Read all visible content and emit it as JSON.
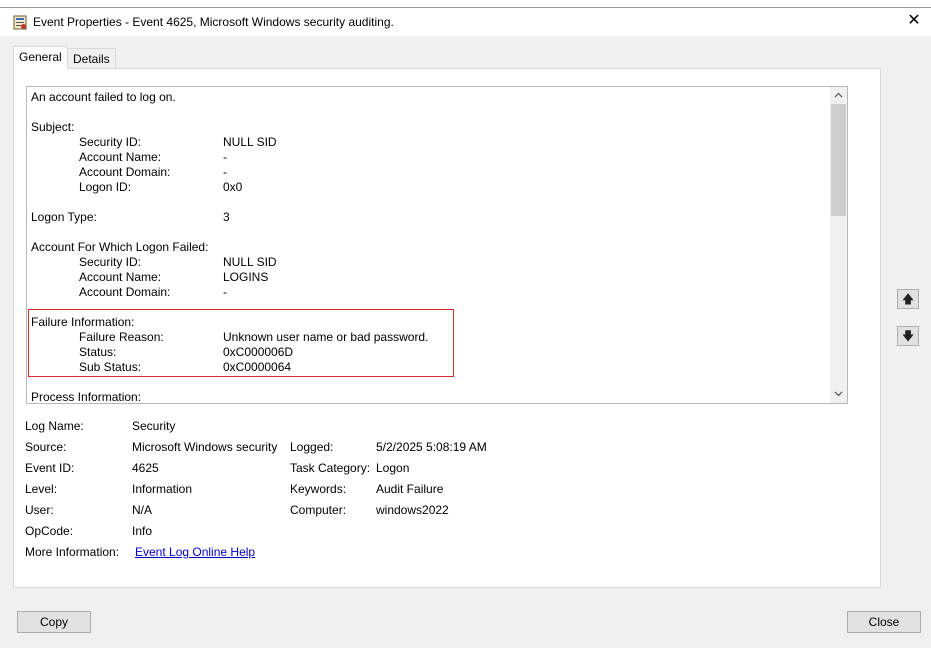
{
  "window": {
    "title": "Event Properties - Event 4625, Microsoft Windows security auditing.",
    "close_glyph": "✕"
  },
  "tabs": [
    {
      "label": "General",
      "active": true
    },
    {
      "label": "Details",
      "active": false
    }
  ],
  "description": {
    "lines": {
      "summary": "An account failed to log on.",
      "subject_header": "Subject:",
      "subj_sid_label": "Security ID:",
      "subj_sid_value": "NULL SID",
      "subj_name_label": "Account Name:",
      "subj_name_value": "-",
      "subj_domain_label": "Account Domain:",
      "subj_domain_value": "-",
      "subj_logonid_label": "Logon ID:",
      "subj_logonid_value": "0x0",
      "logon_type_label": "Logon Type:",
      "logon_type_value": "3",
      "failed_header": "Account For Which Logon Failed:",
      "fail_sid_label": "Security ID:",
      "fail_sid_value": "NULL SID",
      "fail_name_label": "Account Name:",
      "fail_name_value": "LOGINS",
      "fail_domain_label": "Account Domain:",
      "fail_domain_value": "-",
      "failure_header": "Failure Information:",
      "reason_label": "Failure Reason:",
      "reason_value": "Unknown user name or bad password.",
      "status_label": "Status:",
      "status_value": "0xC000006D",
      "substatus_label": "Sub Status:",
      "substatus_value": "0xC0000064",
      "process_header": "Process Information:"
    },
    "highlight_color": "#d03030"
  },
  "details": {
    "log_name_label": "Log Name:",
    "log_name_value": "Security",
    "source_label": "Source:",
    "source_value": "Microsoft Windows security",
    "logged_label": "Logged:",
    "logged_value": "5/2/2025 5:08:19 AM",
    "event_id_label": "Event ID:",
    "event_id_value": "4625",
    "task_category_label": "Task Category:",
    "task_category_value": "Logon",
    "level_label": "Level:",
    "level_value": "Information",
    "keywords_label": "Keywords:",
    "keywords_value": "Audit Failure",
    "user_label": "User:",
    "user_value": "N/A",
    "computer_label": "Computer:",
    "computer_value": "windows2022",
    "opcode_label": "OpCode:",
    "opcode_value": "Info",
    "more_info_label": "More Information:",
    "more_info_link": "Event Log Online Help"
  },
  "buttons": {
    "copy": "Copy",
    "close": "Close",
    "up_glyph": "🡅",
    "down_glyph": "🡇"
  },
  "icons": {
    "title": "event-log-icon",
    "up": "arrow-up-icon",
    "down": "arrow-down-icon"
  }
}
